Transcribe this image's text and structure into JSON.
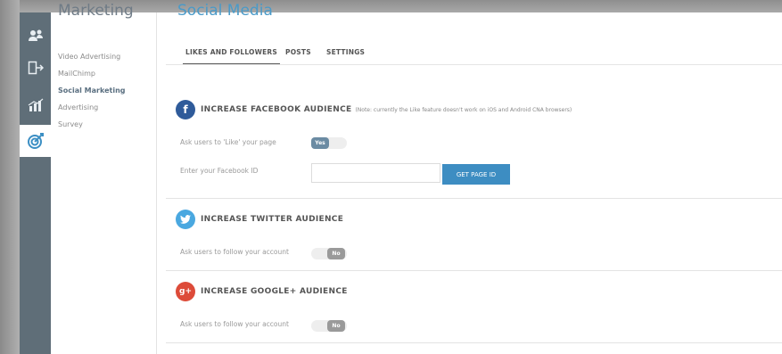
{
  "sidebar": {
    "title": "Marketing",
    "items": [
      {
        "label": "Video Advertising",
        "active": false
      },
      {
        "label": "MailChimp",
        "active": false
      },
      {
        "label": "Social Marketing",
        "active": true
      },
      {
        "label": "Advertising",
        "active": false
      },
      {
        "label": "Survey",
        "active": false
      }
    ]
  },
  "rail": {
    "icons": [
      "users-icon",
      "exit-screen-icon",
      "chart-icon",
      "target-icon"
    ],
    "active": "target-icon"
  },
  "main": {
    "title": "Social Media",
    "tabs": [
      {
        "label": "LIKES AND FOLLOWERS",
        "active": true
      },
      {
        "label": "POSTS",
        "active": false
      },
      {
        "label": "SETTINGS",
        "active": false
      }
    ]
  },
  "facebook": {
    "title": "INCREASE FACEBOOK AUDIENCE",
    "note": "(Note: currently the Like feature doesn't work on iOS and Android CNA browsers)",
    "ask_label": "Ask users to 'Like' your page",
    "toggle": "Yes",
    "id_label": "Enter your Facebook ID",
    "id_value": "",
    "button": "GET PAGE ID",
    "color": "#2f5b9a"
  },
  "twitter": {
    "title": "INCREASE TWITTER AUDIENCE",
    "ask_label": "Ask users to follow your account",
    "toggle": "No",
    "color": "#4aa8e0"
  },
  "google": {
    "title": "INCREASE GOOGLE+ AUDIENCE",
    "ask_label": "Ask users to follow your account",
    "toggle": "No",
    "color": "#dd4b39"
  }
}
